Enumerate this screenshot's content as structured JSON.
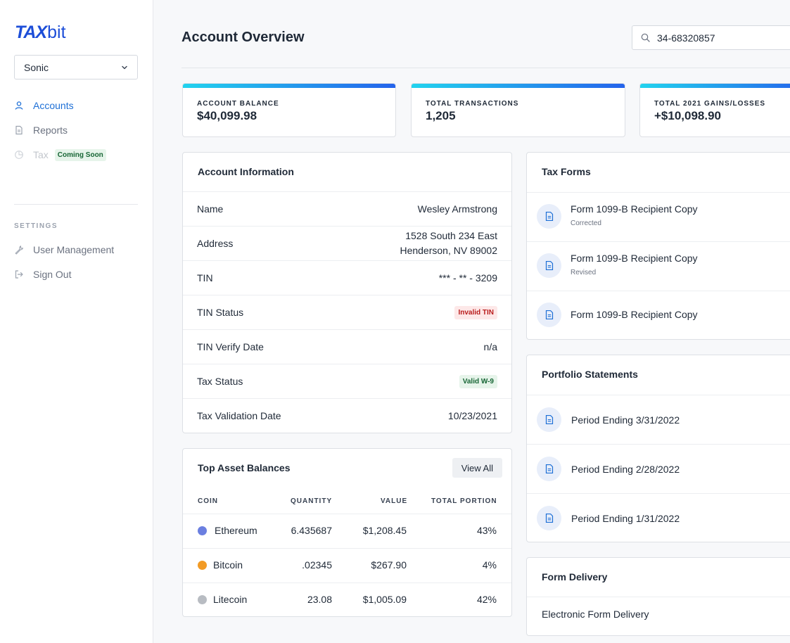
{
  "brand": {
    "name_bold": "TAX",
    "name_light": "bit"
  },
  "sidebar": {
    "org_select": "Sonic",
    "nav": [
      {
        "label": "Accounts",
        "icon": "user-icon",
        "state": "active"
      },
      {
        "label": "Reports",
        "icon": "document-icon",
        "state": "normal"
      },
      {
        "label": "Tax",
        "icon": "pie-chart-icon",
        "state": "disabled",
        "badge": "Coming Soon"
      }
    ],
    "settings_label": "SETTINGS",
    "settings_nav": [
      {
        "label": "User Management",
        "icon": "wrench-icon"
      },
      {
        "label": "Sign Out",
        "icon": "sign-out-icon"
      }
    ]
  },
  "header": {
    "title": "Account Overview",
    "search_value": "34-68320857"
  },
  "stats": [
    {
      "label": "ACCOUNT BALANCE",
      "value": "$40,099.98"
    },
    {
      "label": "TOTAL TRANSACTIONS",
      "value": "1,205"
    },
    {
      "label": "TOTAL 2021 GAINS/LOSSES",
      "value": "+$10,098.90"
    }
  ],
  "account_info": {
    "title": "Account Information",
    "rows": [
      {
        "label": "Name",
        "value": "Wesley Armstrong"
      },
      {
        "label": "Address",
        "value_line1": "1528 South 234 East",
        "value_line2": "Henderson, NV 89002"
      },
      {
        "label": "TIN",
        "value": "*** - ** - 3209"
      },
      {
        "label": "TIN Status",
        "value": "Invalid TIN"
      },
      {
        "label": "TIN Verify Date",
        "value": "n/a"
      },
      {
        "label": "Tax Status",
        "value": "Valid W-9"
      },
      {
        "label": "Tax Validation Date",
        "value": "10/23/2021"
      }
    ]
  },
  "assets": {
    "title": "Top Asset Balances",
    "view_all": "View All",
    "columns": [
      "COIN",
      "QUANTITY",
      "VALUE",
      "TOTAL PORTION"
    ],
    "rows": [
      {
        "coin": "Ethereum",
        "quantity": "6.435687",
        "value": "$1,208.45",
        "portion": "43%",
        "color": "#6b7fe0"
      },
      {
        "coin": "Bitcoin",
        "quantity": ".02345",
        "value": "$267.90",
        "portion": "4%",
        "color": "#f29b25"
      },
      {
        "coin": "Litecoin",
        "quantity": "23.08",
        "value": "$1,005.09",
        "portion": "42%",
        "color": "#b8bcc2"
      }
    ]
  },
  "tax_forms": {
    "title": "Tax Forms",
    "items": [
      {
        "title": "Form 1099-B Recipient Copy",
        "sub": "Corrected"
      },
      {
        "title": "Form 1099-B Recipient Copy",
        "sub": "Revised"
      },
      {
        "title": "Form 1099-B Recipient Copy",
        "sub": ""
      }
    ]
  },
  "portfolio": {
    "title": "Portfolio Statements",
    "items": [
      {
        "title": "Period Ending 3/31/2022"
      },
      {
        "title": "Period Ending 2/28/2022"
      },
      {
        "title": "Period Ending 1/31/2022"
      }
    ]
  },
  "delivery": {
    "title": "Form Delivery",
    "item": "Electronic Form Delivery"
  },
  "colors": {
    "accent": "#1d6fd6",
    "gradient_start": "#22d3ee",
    "gradient_end": "#2563eb"
  }
}
